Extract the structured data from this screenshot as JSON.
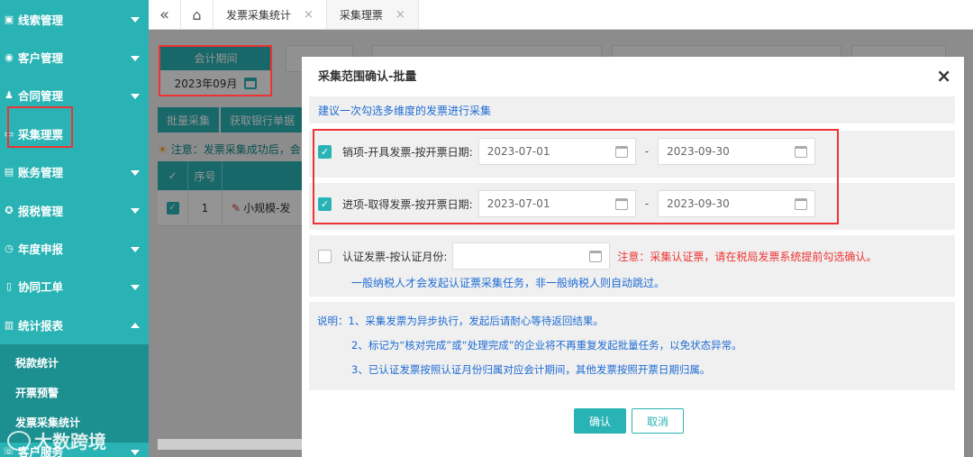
{
  "sidebar": {
    "items": [
      {
        "label": "线索管理",
        "icon": "briefcase-icon"
      },
      {
        "label": "客户管理",
        "icon": "user-icon"
      },
      {
        "label": "合同管理",
        "icon": "person-icon"
      },
      {
        "label": "采集理票",
        "icon": "card-icon"
      },
      {
        "label": "账务管理",
        "icon": "ledger-icon"
      },
      {
        "label": "报税管理",
        "icon": "gear-icon"
      },
      {
        "label": "年度申报",
        "icon": "calendar-icon"
      },
      {
        "label": "协同工单",
        "icon": "document-icon"
      },
      {
        "label": "统计报表",
        "icon": "chart-icon"
      }
    ],
    "sub_items": [
      "税款统计",
      "开票预警",
      "发票采集统计"
    ],
    "bottom_item": "客户服务",
    "watermark": "大数跨境"
  },
  "tabs": [
    {
      "label": "发票采集统计",
      "close": "×"
    },
    {
      "label": "采集理票",
      "close": "×"
    }
  ],
  "topbar": {
    "collapse": "«",
    "home": "⌂"
  },
  "main": {
    "period_label": "会计期间",
    "period_value": "2023年09月",
    "btn_bulk": "批量采集",
    "btn_bank": "获取银行单据",
    "notice": "注意：发票采集成功后，会",
    "table_headers": [
      "✓",
      "序号",
      ""
    ],
    "table_row": {
      "index": "1",
      "name": "小规模-发"
    }
  },
  "modal": {
    "title": "采集范围确认-批量",
    "close": "×",
    "hint": "建议一次勾选多维度的发票进行采集",
    "row1": {
      "label": "销项-开具发票-按开票日期:",
      "start": "2023-07-01",
      "end": "2023-09-30",
      "dash": "-"
    },
    "row2": {
      "label": "进项-取得发票-按开票日期:",
      "start": "2023-07-01",
      "end": "2023-09-30",
      "dash": "-"
    },
    "row3": {
      "label": "认证发票-按认证月份:",
      "value": "",
      "warn": "注意：采集认证票，请在税局发票系统提前勾选确认。",
      "sub": "一般纳税人才会发起认证票采集任务，非一般纳税人则自动跳过。"
    },
    "notes": [
      "说明：1、采集发票为异步执行，发起后请耐心等待返回结果。",
      "2、标记为“核对完成”或“处理完成”的企业将不再重复发起批量任务，以免状态异常。",
      "3、已认证发票按照认证月份归属对应会计期间，其他发票按照开票日期归属。"
    ],
    "confirm": "确认",
    "cancel": "取消"
  },
  "colors": {
    "accent": "#2ab3b5",
    "warn": "#ee3333",
    "link": "#1e6cd4"
  }
}
